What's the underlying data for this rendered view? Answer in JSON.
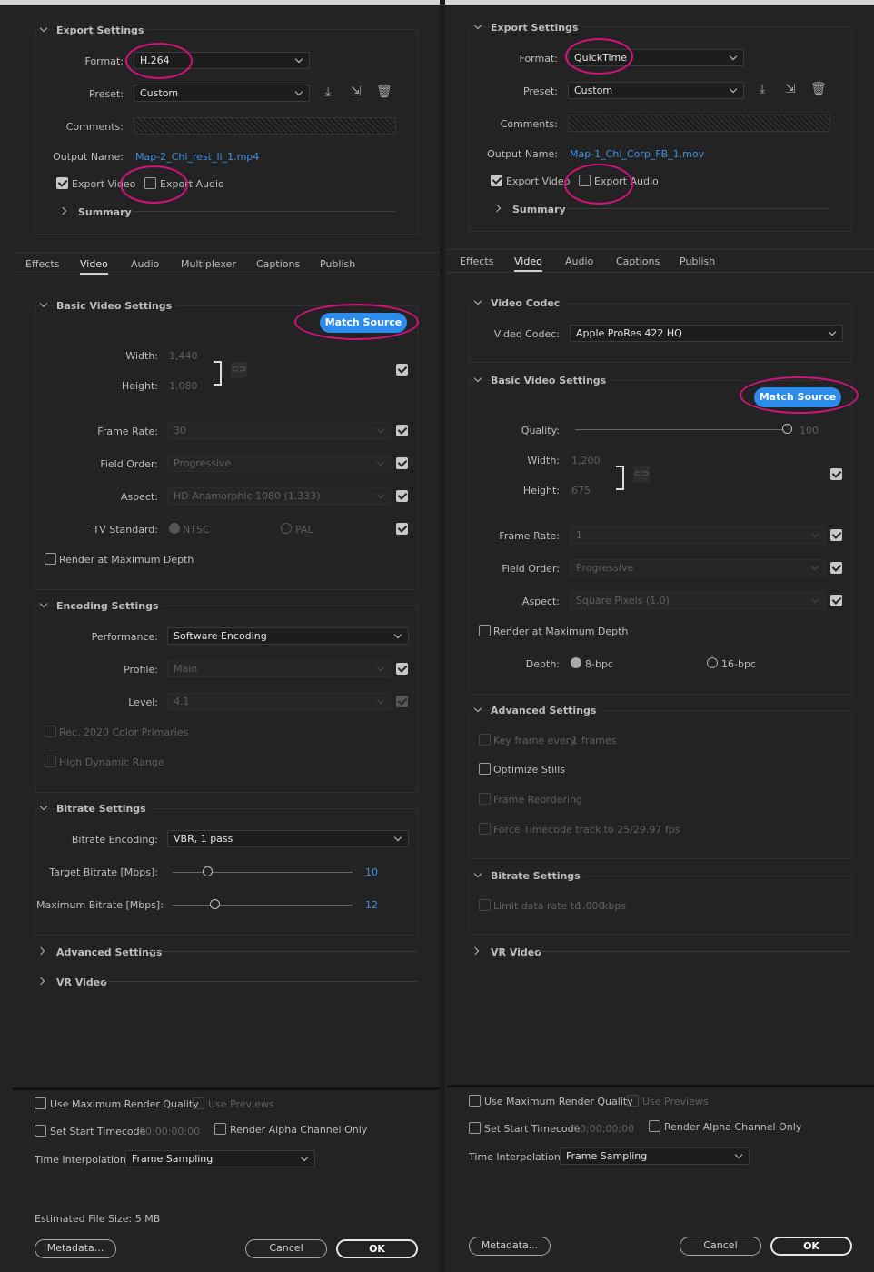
{
  "left": {
    "export_settings": {
      "header": "Export Settings",
      "format_label": "Format:",
      "format_value": "H.264",
      "preset_label": "Preset:",
      "preset_value": "Custom",
      "comments_label": "Comments:",
      "output_name_label": "Output Name:",
      "output_name_value": "Map-2_Chi_rest_li_1.mp4",
      "export_video_label": "Export Video",
      "export_audio_label": "Export Audio",
      "summary_label": "Summary"
    },
    "tabs": [
      "Effects",
      "Video",
      "Audio",
      "Multiplexer",
      "Captions",
      "Publish"
    ],
    "basic_video": {
      "header": "Basic Video Settings",
      "match_source": "Match Source",
      "width_label": "Width:",
      "width_value": "1,440",
      "height_label": "Height:",
      "height_value": "1,080",
      "frame_rate_label": "Frame Rate:",
      "frame_rate_value": "30",
      "field_order_label": "Field Order:",
      "field_order_value": "Progressive",
      "aspect_label": "Aspect:",
      "aspect_value": "HD Anamorphic 1080 (1.333)",
      "tv_standard_label": "TV Standard:",
      "ntsc": "NTSC",
      "pal": "PAL",
      "render_max_depth": "Render at Maximum Depth"
    },
    "encoding": {
      "header": "Encoding Settings",
      "performance_label": "Performance:",
      "performance_value": "Software Encoding",
      "profile_label": "Profile:",
      "profile_value": "Main",
      "level_label": "Level:",
      "level_value": "4.1",
      "rec2020": "Rec. 2020 Color Primaries",
      "hdr": "High Dynamic Range"
    },
    "bitrate": {
      "header": "Bitrate Settings",
      "encoding_label": "Bitrate Encoding:",
      "encoding_value": "VBR, 1 pass",
      "target_label": "Target Bitrate [Mbps]:",
      "target_value": "10",
      "max_label": "Maximum Bitrate [Mbps]:",
      "max_value": "12",
      "target_level": 0.19,
      "max_level": 0.24
    },
    "advanced_label": "Advanced Settings",
    "vr_label": "VR Video",
    "bottom": {
      "use_max_quality": "Use Maximum Render Quality",
      "use_previews": "Use Previews",
      "set_start_tc": "Set Start Timecode",
      "tc_value": "00:00:00:00",
      "render_alpha": "Render Alpha Channel Only",
      "time_interp_label": "Time Interpolation:",
      "time_interp_value": "Frame Sampling",
      "est_size": "Estimated File Size:  5 MB",
      "metadata": "Metadata...",
      "cancel": "Cancel",
      "ok": "OK"
    }
  },
  "right": {
    "export_settings": {
      "header": "Export Settings",
      "format_label": "Format:",
      "format_value": "QuickTime",
      "preset_label": "Preset:",
      "preset_value": "Custom",
      "comments_label": "Comments:",
      "output_name_label": "Output Name:",
      "output_name_value": "Map-1_Chi_Corp_FB_1.mov",
      "export_video_label": "Export Video",
      "export_audio_label": "Export Audio",
      "summary_label": "Summary"
    },
    "tabs": [
      "Effects",
      "Video",
      "Audio",
      "Captions",
      "Publish"
    ],
    "video_codec": {
      "header": "Video Codec",
      "codec_label": "Video Codec:",
      "codec_value": "Apple ProRes 422 HQ"
    },
    "basic_video": {
      "header": "Basic Video Settings",
      "match_source": "Match Source",
      "quality_label": "Quality:",
      "quality_value": "100",
      "quality_level": 1.0,
      "width_label": "Width:",
      "width_value": "1,200",
      "height_label": "Height:",
      "height_value": "675",
      "frame_rate_label": "Frame Rate:",
      "frame_rate_value": "1",
      "field_order_label": "Field Order:",
      "field_order_value": "Progressive",
      "aspect_label": "Aspect:",
      "aspect_value": "Square Pixels (1.0)",
      "render_max_depth": "Render at Maximum Depth",
      "depth_label": "Depth:",
      "depth_8": "8-bpc",
      "depth_16": "16-bpc"
    },
    "advanced": {
      "header": "Advanced Settings",
      "keyframe": "Key frame every",
      "keyframe_value": "1",
      "keyframe_unit": "frames",
      "optimize_stills": "Optimize Stills",
      "frame_reordering": "Frame Reordering",
      "force_tc": "Force Timecode track to 25/29.97 fps"
    },
    "bitrate": {
      "header": "Bitrate Settings",
      "limit_label": "Limit data rate to",
      "limit_value": "1,000",
      "limit_unit": "kbps"
    },
    "vr_label": "VR Video",
    "bottom": {
      "use_max_quality": "Use Maximum Render Quality",
      "use_previews": "Use Previews",
      "set_start_tc": "Set Start Timecode",
      "tc_value": "00;00;00;00",
      "render_alpha": "Render Alpha Channel Only",
      "time_interp_label": "Time Interpolation:",
      "time_interp_value": "Frame Sampling",
      "metadata": "Metadata...",
      "cancel": "Cancel",
      "ok": "OK"
    }
  },
  "colors": {
    "accent_blue": "#2d8ceb",
    "annotation_magenta": "#d4127c",
    "link_blue": "#3d8fe0"
  }
}
